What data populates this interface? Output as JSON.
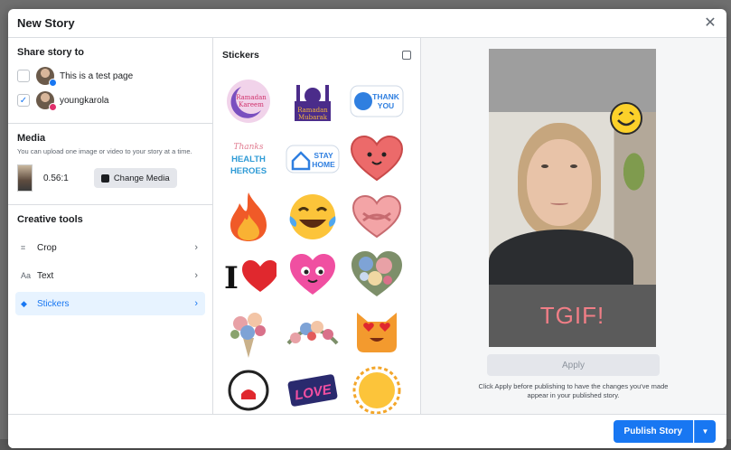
{
  "dialog": {
    "title": "New Story",
    "close_symbol": "✕"
  },
  "share": {
    "title": "Share story to",
    "targets": [
      {
        "label": "This is a test page",
        "checked": false,
        "badge_color": "#1877f2"
      },
      {
        "label": "youngkarola",
        "checked": true,
        "check_symbol": "✓",
        "badge_color": "#e1306c"
      }
    ]
  },
  "media": {
    "title": "Media",
    "hint": "You can upload one image or video to your story at a time.",
    "ratio": "0.56:1",
    "change_label": "Change Media"
  },
  "creative_tools": {
    "title": "Creative tools",
    "items": [
      {
        "label": "Crop",
        "icon": "crop-icon",
        "glyph": "⌗"
      },
      {
        "label": "Text",
        "icon": "text-icon",
        "glyph": "Aa"
      },
      {
        "label": "Stickers",
        "icon": "sticker-icon",
        "glyph": "◆",
        "active": true
      }
    ],
    "chevron": "›"
  },
  "stickers": {
    "title": "Stickers",
    "items": [
      "ramadan-kareem-sticker",
      "ramadan-mubarak-sticker",
      "thank-you-sticker",
      "thanks-health-heroes-sticker",
      "stay-home-sticker",
      "smiling-heart-sticker",
      "fire-sticker",
      "tears-of-joy-sticker",
      "hugging-heart-sticker",
      "i-love-sticker",
      "pink-heart-face-sticker",
      "floral-heart-sticker",
      "flower-bouquet-sticker",
      "flower-garland-sticker",
      "heart-eyes-cat-sticker",
      "partial-sticker-1",
      "love-sticker",
      "sun-sticker"
    ],
    "labels": {
      "ramadan_kareem_1": "Ramadan",
      "ramadan_kareem_2": "Kareem",
      "ramadan_mubarak_1": "Ramadan",
      "ramadan_mubarak_2": "Mubarak",
      "thank_you_1": "THANK",
      "thank_you_2": "YOU",
      "heroes_1": "Thanks",
      "heroes_2": "HEALTH",
      "heroes_3": "HEROES",
      "stay_home_1": "STAY",
      "stay_home_2": "HOME",
      "love": "LOVE",
      "i_letter": "I"
    }
  },
  "preview": {
    "overlay_text": "TGIF!",
    "apply_label": "Apply",
    "apply_note": "Click Apply before publishing to have the changes you've made appear in your published story."
  },
  "footer": {
    "publish_label": "Publish Story",
    "caret": "▼"
  },
  "colors": {
    "accent": "#1877f2",
    "tgif": "#f07e86"
  }
}
